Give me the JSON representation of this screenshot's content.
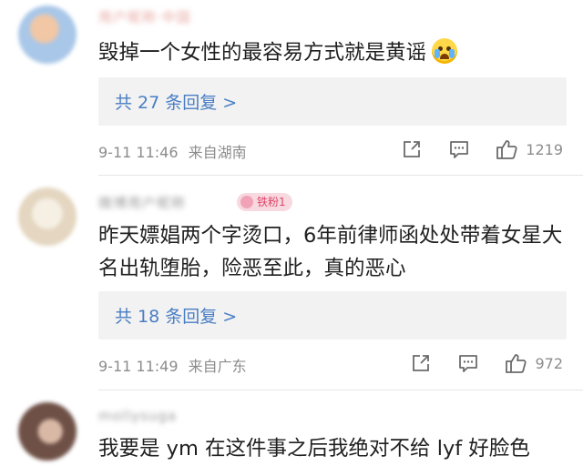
{
  "comments": [
    {
      "username": "用户昵称·中国",
      "text": "毁掉一个女性的最容易方式就是黄谣",
      "emoji": "crying-emoji",
      "reply_label": "共 27 条回复 >",
      "time": "9-11 11:46",
      "location": "来自湖南",
      "likes": "1219",
      "avatar_color": "#a9c7e8"
    },
    {
      "username": "微博用户昵称",
      "badge": "铁粉1",
      "text": "昨天嫖娼两个字烫口，6年前律师函处处带着女星大名出轨堕胎，险恶至此，真的恶心",
      "reply_label": "共 18 条回复 >",
      "time": "9-11 11:49",
      "location": "来自广东",
      "likes": "972",
      "avatar_color": "#e8dcc8"
    },
    {
      "username": "mollysuga",
      "text": "我要是 ym 在这件事之后我绝对不给 lyf 好脸色",
      "avatar_color": "#8a6a5c"
    }
  ],
  "icons": {
    "share": "share-icon",
    "comment": "comment-icon",
    "like": "thumbs-up-icon"
  },
  "colors": {
    "link": "#4a7ec4",
    "meta": "#8c8c8c",
    "reply_bg": "#f2f2f2",
    "badge_bg": "#f7d9df",
    "badge_text": "#e0456a"
  }
}
